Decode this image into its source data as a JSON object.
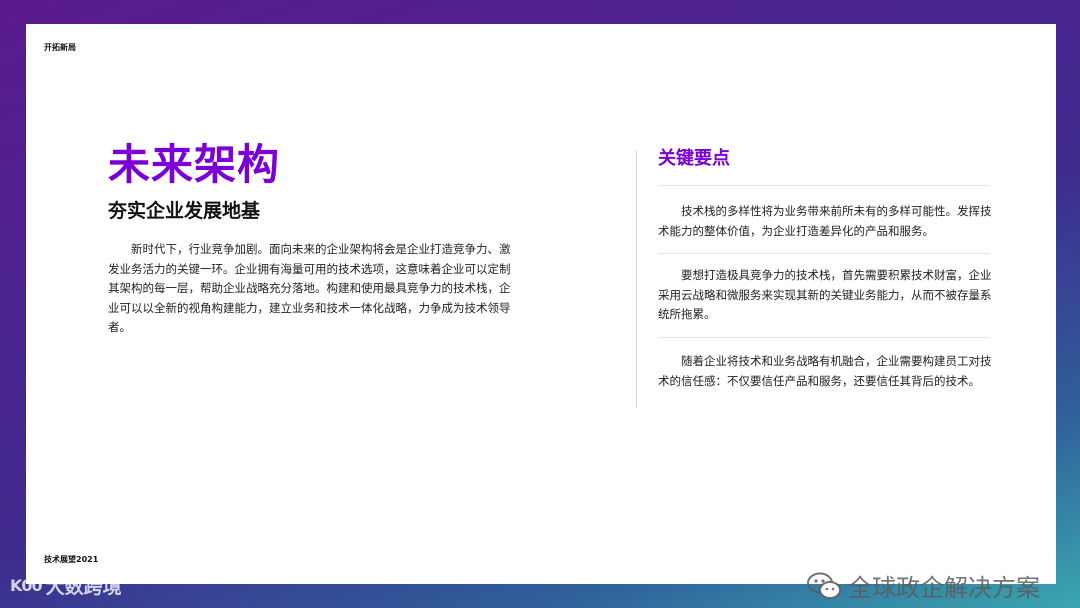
{
  "header": {
    "label": "开拓新局"
  },
  "footer": {
    "label": "技术展望2021"
  },
  "main": {
    "title": "未来架构",
    "subtitle": "夯实企业发展地基",
    "body": "新时代下，行业竞争加剧。面向未来的企业架构将会是企业打造竞争力、激发业务活力的关键一环。企业拥有海量可用的技术选项，这意味着企业可以定制其架构的每一层，帮助企业战略充分落地。构建和使用最具竞争力的技术栈，企业可以以全新的视角构建能力，建立业务和技术一体化战略，力争成为技术领导者。"
  },
  "key_points": {
    "title": "关键要点",
    "items": [
      "技术栈的多样性将为业务带来前所未有的多样可能性。发挥技术能力的整体价值，为企业打造差异化的产品和服务。",
      "要想打造极具竞争力的技术栈，首先需要积累技术财富，企业采用云战略和微服务来实现其新的关键业务能力，从而不被存量系统所拖累。",
      "随着企业将技术和业务战略有机融合，企业需要构建员工对技术的信任感：不仅要信任产品和服务，还要信任其背后的技术。"
    ]
  },
  "watermarks": {
    "left_logo": "K00",
    "left_text": "大数跨境",
    "right_text": "全球政企解决方案"
  }
}
